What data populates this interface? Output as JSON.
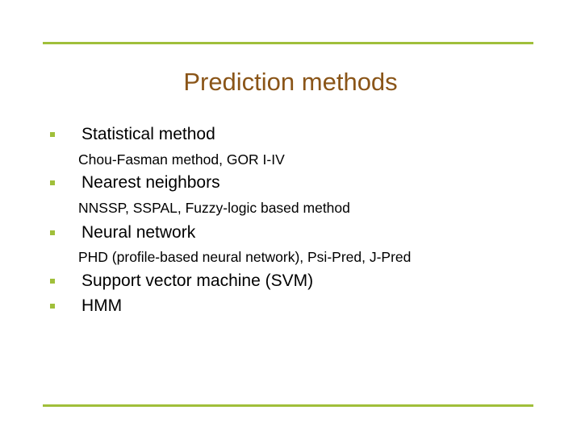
{
  "slide": {
    "title": "Prediction methods",
    "accent_color": "#a0bf3a",
    "title_color": "#8a5518",
    "items": [
      {
        "label": "Statistical method",
        "sub": "Chou-Fasman method, GOR I-IV"
      },
      {
        "label": "Nearest neighbors",
        "sub": "NNSSP, SSPAL, Fuzzy-logic based method"
      },
      {
        "label": "Neural network",
        "sub": "PHD (profile-based neural network), Psi-Pred, J-Pred"
      },
      {
        "label": "Support vector machine (SVM)"
      },
      {
        "label": "HMM"
      }
    ]
  }
}
